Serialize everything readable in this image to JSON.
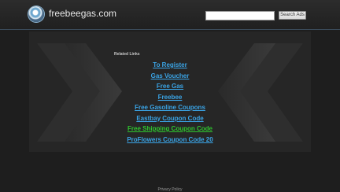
{
  "header": {
    "site_name": "freebeegas.com",
    "search_placeholder": "",
    "search_button": "Search Ads"
  },
  "related": {
    "title": "Related Links",
    "links": [
      {
        "label": "To Register",
        "color": "#3aa4e6"
      },
      {
        "label": "Gas Voucher",
        "color": "#3aa4e6"
      },
      {
        "label": "Free Gas",
        "color": "#3aa4e6"
      },
      {
        "label": "Freebee",
        "color": "#3aa4e6"
      },
      {
        "label": "Free Gasoline Coupons",
        "color": "#3aa4e6"
      },
      {
        "label": "Eastbay Coupon Code",
        "color": "#3aa4e6"
      },
      {
        "label": "Free Shipping Coupon Code",
        "color": "#2ec62e"
      },
      {
        "label": "ProFlowers Coupon Code 20",
        "color": "#3aa4e6"
      }
    ]
  },
  "footer": {
    "privacy": "Privacy Policy"
  },
  "colors": {
    "background": "#1e1e1e",
    "link": "#3aa4e6",
    "visited_link": "#2ec62e"
  }
}
